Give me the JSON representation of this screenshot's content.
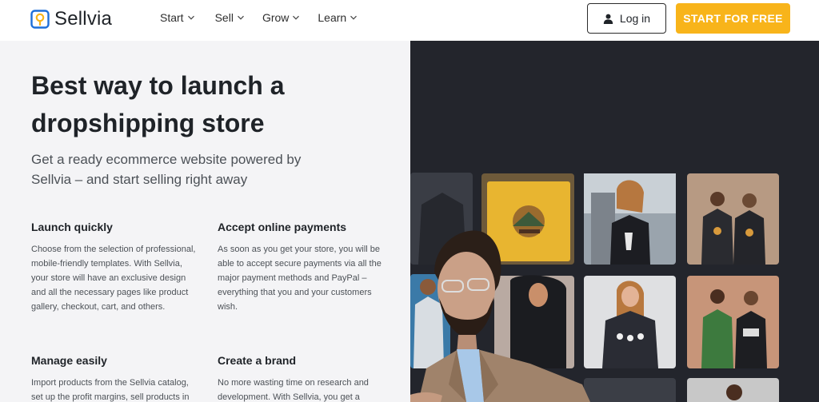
{
  "header": {
    "brand": "Sellvia",
    "nav": [
      {
        "label": "Start"
      },
      {
        "label": "Sell"
      },
      {
        "label": "Grow"
      },
      {
        "label": "Learn"
      }
    ],
    "login_label": "Log in",
    "cta_label": "START FOR FREE"
  },
  "hero": {
    "title": "Best way to launch a dropshipping store",
    "subtitle": "Get a ready ecommerce website powered by Sellvia – and start selling right away"
  },
  "features": [
    {
      "title": "Launch quickly",
      "text": "Choose from the selection of professional, mobile-friendly templates. With Sellvia, your store will have an exclusive design and all the necessary pages like product gallery, checkout, cart, and others."
    },
    {
      "title": "Accept online payments",
      "text": "As soon as you get your store, you will be able to accept secure payments via all the major payment methods and PayPal – everything that you and your customers wish."
    },
    {
      "title": "Manage easily",
      "text": "Import products from the Sellvia catalog, set up the profit margins, sell products in"
    },
    {
      "title": "Create a brand",
      "text": "No more wasting time on research and development. With Sellvia, you get a"
    }
  ],
  "colors": {
    "accent": "#f8b41a",
    "dark_panel": "#23252c",
    "light_panel": "#f4f4f6",
    "brand_blue": "#1e6fd9"
  }
}
